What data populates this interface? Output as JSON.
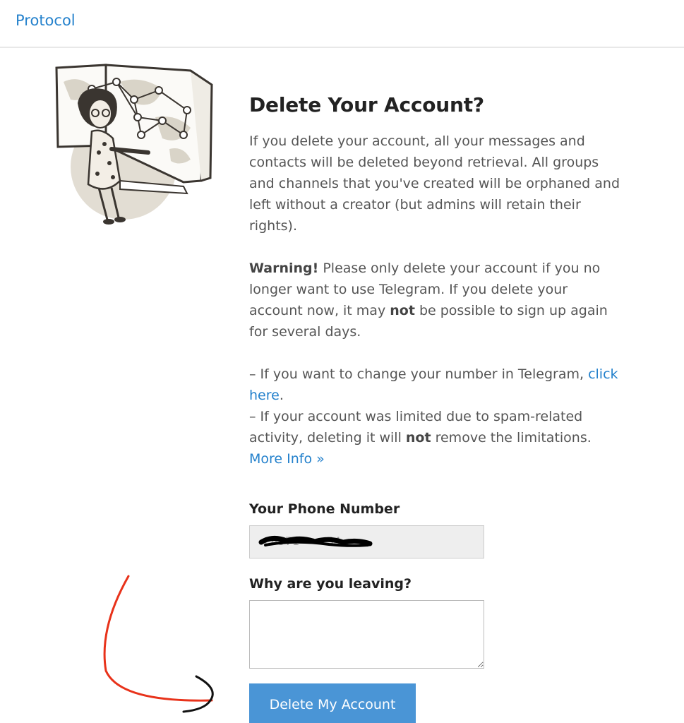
{
  "header": {
    "link_label": "Protocol"
  },
  "main": {
    "title": "Delete Your Account?",
    "p1": "If you delete your account, all your messages and contacts will be deleted beyond retrieval. All groups and channels that you've created will be orphaned and left without a creator (but admins will retain their rights).",
    "warning_bold": "Warning!",
    "warning_a": " Please only delete your account if you no longer want to use Telegram. If you delete your account now, it may ",
    "warning_not": "not",
    "warning_b": " be possible to sign up again for several days.",
    "change_number_text": "– If you want to change your number in Telegram, ",
    "click_here": "click here",
    "period": ".",
    "spam_text": "– If your account was limited due to spam-related activity, deleting it will ",
    "spam_not": "not",
    "spam_text_b": " remove the limitations.",
    "more_info": "More Info »"
  },
  "form": {
    "phone_label": "Your Phone Number",
    "phone_value": "+8971 ••• 54",
    "reason_label": "Why are you leaving?",
    "reason_value": "",
    "submit_label": "Delete My Account"
  },
  "colors": {
    "link": "#2481cc",
    "button": "#4a95d6",
    "annotation_arrow": "#e8321a"
  },
  "icons": {
    "illustration": "woman-at-world-map-illustration"
  }
}
